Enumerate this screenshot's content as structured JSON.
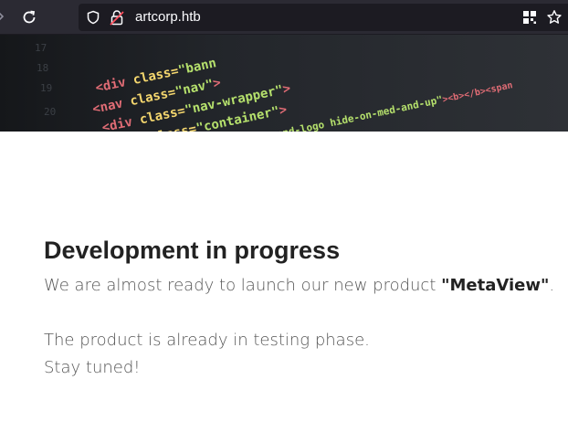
{
  "browser": {
    "url": "artcorp.htb",
    "icons": [
      "back-arrow-icon",
      "reload-icon",
      "shield-icon",
      "lock-icon",
      "reader-view-icon",
      "bookmark-star-icon"
    ],
    "colors": {
      "toolbar": "#2b2a33",
      "urlbar": "#1c1b22"
    }
  },
  "banner": {
    "code_lines": [
      "<div class=\"bann",
      "<nav class=\"nav\">",
      "<div class=\"nav-wrapper\">",
      "<div class=\"container\">",
      "<a href=\"#\" class=\"brand-logo hide-on-med-and-up\"><b></b><span"
    ],
    "colors": {
      "tag": "#e06c75",
      "attr": "#f5d76e",
      "string": "#b5e06c"
    }
  },
  "main": {
    "title": "Development in progress",
    "intro_prefix": "We are almost ready to launch our new product ",
    "product_name": "\"MetaView\"",
    "intro_suffix": ".",
    "line2": "The product is already in testing phase.",
    "line3": "Stay tuned!"
  }
}
